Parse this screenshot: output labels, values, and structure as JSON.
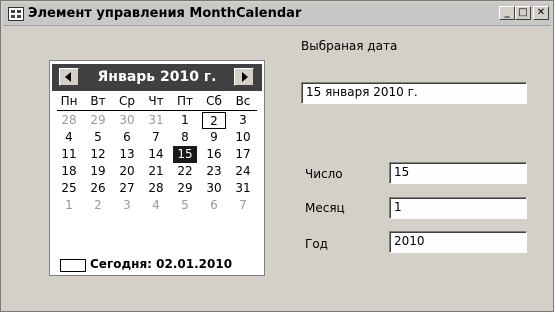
{
  "window": {
    "title": "Элемент управления MonthCalendar",
    "controls": {
      "minimize": "_",
      "maximize": "□",
      "close": "✕"
    }
  },
  "calendar": {
    "month_label": "Январь 2010 г.",
    "weekdays": [
      "Пн",
      "Вт",
      "Ср",
      "Чт",
      "Пт",
      "Сб",
      "Вс"
    ],
    "weeks": [
      [
        {
          "d": "28",
          "o": true
        },
        {
          "d": "29",
          "o": true
        },
        {
          "d": "30",
          "o": true
        },
        {
          "d": "31",
          "o": true
        },
        {
          "d": "1"
        },
        {
          "d": "2",
          "today": true
        },
        {
          "d": "3"
        }
      ],
      [
        {
          "d": "4"
        },
        {
          "d": "5"
        },
        {
          "d": "6"
        },
        {
          "d": "7"
        },
        {
          "d": "8"
        },
        {
          "d": "9"
        },
        {
          "d": "10"
        }
      ],
      [
        {
          "d": "11"
        },
        {
          "d": "12"
        },
        {
          "d": "13"
        },
        {
          "d": "14"
        },
        {
          "d": "15",
          "selected": true
        },
        {
          "d": "16"
        },
        {
          "d": "17"
        }
      ],
      [
        {
          "d": "18"
        },
        {
          "d": "19"
        },
        {
          "d": "20"
        },
        {
          "d": "21"
        },
        {
          "d": "22"
        },
        {
          "d": "23"
        },
        {
          "d": "24"
        }
      ],
      [
        {
          "d": "25"
        },
        {
          "d": "26"
        },
        {
          "d": "27"
        },
        {
          "d": "28"
        },
        {
          "d": "29"
        },
        {
          "d": "30"
        },
        {
          "d": "31"
        }
      ],
      [
        {
          "d": "1",
          "o": true
        },
        {
          "d": "2",
          "o": true
        },
        {
          "d": "3",
          "o": true
        },
        {
          "d": "4",
          "o": true
        },
        {
          "d": "5",
          "o": true
        },
        {
          "d": "6",
          "o": true
        },
        {
          "d": "7",
          "o": true
        }
      ]
    ],
    "today_label": "Сегодня: 02.01.2010"
  },
  "form": {
    "selected_date_label": "Выбраная дата",
    "selected_date_value": "15 января 2010 г.",
    "day_label": "Число",
    "day_value": "15",
    "month_label": "Месяц",
    "month_value": "1",
    "year_label": "Год",
    "year_value": "2010"
  }
}
